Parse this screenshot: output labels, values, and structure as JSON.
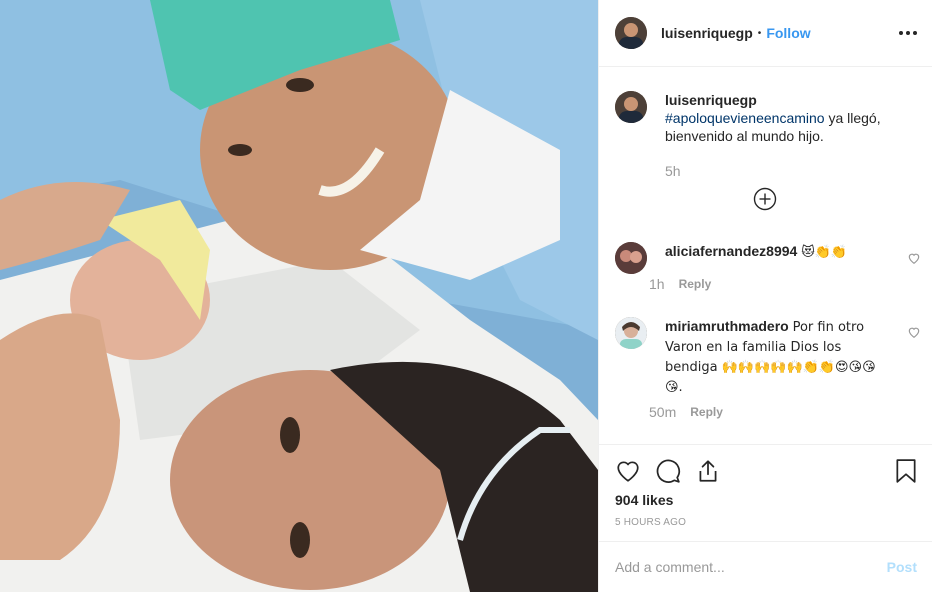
{
  "header": {
    "username": "luisenriquegp",
    "separator": "•",
    "follow_label": "Follow",
    "more_icon": "more-horizontal-icon"
  },
  "caption": {
    "username": "luisenriquegp",
    "hashtag": "#apoloquevieneencamino",
    "text": " ya llegó, bienvenido al mundo hijo.",
    "time": "5h"
  },
  "load_more_icon": "plus-circle-icon",
  "comments": [
    {
      "username": "aliciafernandez8994",
      "text": "😻👏👏",
      "time": "1h",
      "reply_label": "Reply"
    },
    {
      "username": "miriamruthmadero",
      "text": "Por fin otro Varon en la familia Dios los bendiga 🙌🙌🙌🙌🙌👏👏😍😘😘😘.",
      "time": "50m",
      "reply_label": "Reply"
    }
  ],
  "actions": {
    "likes": "904 likes",
    "posted_ago": "5 HOURS AGO"
  },
  "add_comment": {
    "placeholder": "Add a comment...",
    "post_label": "Post"
  },
  "colors": {
    "link_blue": "#3897f0",
    "hashtag": "#003569",
    "muted": "#999999",
    "post_disabled": "#b2dffc"
  }
}
